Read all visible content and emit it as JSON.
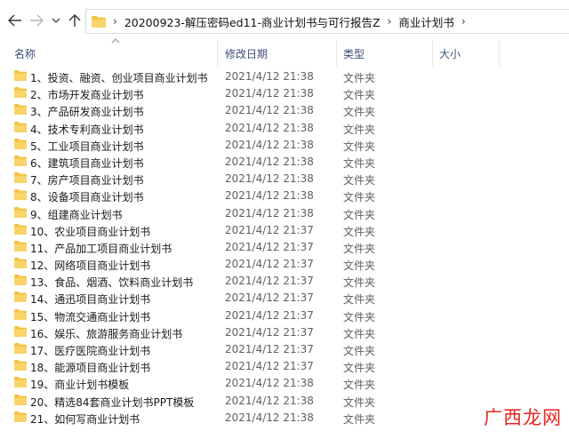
{
  "address_bar": {
    "breadcrumbs": [
      "20200923-解压密码ed11-商业计划书与可行报告Z",
      "商业计划书"
    ]
  },
  "columns": {
    "name": "名称",
    "date": "修改日期",
    "type": "类型",
    "size": "大小"
  },
  "files": [
    {
      "name": "1、投资、融资、创业项目商业计划书",
      "date": "2021/4/12 21:38",
      "type": "文件夹"
    },
    {
      "name": "2、市场开发商业计划书",
      "date": "2021/4/12 21:38",
      "type": "文件夹"
    },
    {
      "name": "3、产品研发商业计划书",
      "date": "2021/4/12 21:38",
      "type": "文件夹"
    },
    {
      "name": "4、技术专利商业计划书",
      "date": "2021/4/12 21:38",
      "type": "文件夹"
    },
    {
      "name": "5、工业项目商业计划书",
      "date": "2021/4/12 21:38",
      "type": "文件夹"
    },
    {
      "name": "6、建筑项目商业计划书",
      "date": "2021/4/12 21:38",
      "type": "文件夹"
    },
    {
      "name": "7、房产项目商业计划书",
      "date": "2021/4/12 21:38",
      "type": "文件夹"
    },
    {
      "name": "8、设备项目商业计划书",
      "date": "2021/4/12 21:38",
      "type": "文件夹"
    },
    {
      "name": "9、组建商业计划书",
      "date": "2021/4/12 21:38",
      "type": "文件夹"
    },
    {
      "name": "10、农业项目商业计划书",
      "date": "2021/4/12 21:37",
      "type": "文件夹"
    },
    {
      "name": "11、产品加工项目商业计划书",
      "date": "2021/4/12 21:37",
      "type": "文件夹"
    },
    {
      "name": "12、网络项目商业计划书",
      "date": "2021/4/12 21:37",
      "type": "文件夹"
    },
    {
      "name": "13、食品、烟酒、饮料商业计划书",
      "date": "2021/4/12 21:37",
      "type": "文件夹"
    },
    {
      "name": "14、通迅项目商业计划书",
      "date": "2021/4/12 21:37",
      "type": "文件夹"
    },
    {
      "name": "15、物流交通商业计划书",
      "date": "2021/4/12 21:37",
      "type": "文件夹"
    },
    {
      "name": "16、娱乐、旅游服务商业计划书",
      "date": "2021/4/12 21:37",
      "type": "文件夹"
    },
    {
      "name": "17、医疗医院商业计划书",
      "date": "2021/4/12 21:37",
      "type": "文件夹"
    },
    {
      "name": "18、能源项目商业计划书",
      "date": "2021/4/12 21:37",
      "type": "文件夹"
    },
    {
      "name": "19、商业计划书模板",
      "date": "2021/4/12 21:38",
      "type": "文件夹"
    },
    {
      "name": "20、精选84套商业计划书PPT模板",
      "date": "2021/4/12 21:38",
      "type": "文件夹"
    },
    {
      "name": "21、如何写商业计划书",
      "date": "2021/4/12 21:38",
      "type": "文件夹"
    }
  ],
  "watermark": "广西龙网",
  "colors": {
    "folder": "#f5c242",
    "header_text": "#3c4f7a",
    "watermark": "#e8261f"
  }
}
